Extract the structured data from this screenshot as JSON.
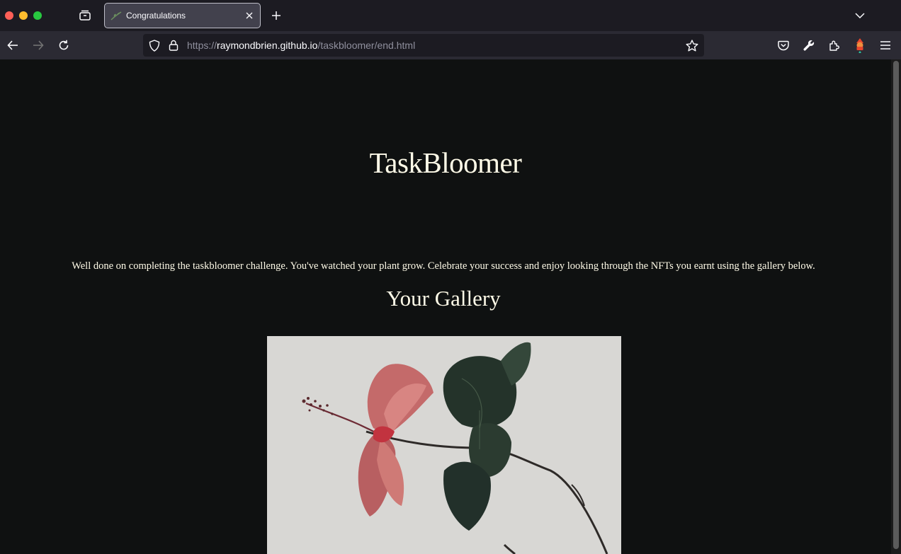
{
  "browser": {
    "tab": {
      "title": "Congratulations"
    },
    "url": {
      "scheme": "https://",
      "host": "raymondbrien.github.io",
      "path": "/taskbloomer/end.html"
    }
  },
  "page": {
    "site_title": "TaskBloomer",
    "intro": "Well done on completing the taskbloomer challenge. You've watched your plant grow. Celebrate your success and enjoy looking through the NFTs you earnt using the gallery below.",
    "gallery_heading": "Your Gallery"
  },
  "colors": {
    "page_background": "#0f1111",
    "text": "#fffbe8",
    "toolbar": "#2b2a33",
    "tabstrip": "#1c1b22"
  },
  "icons": {
    "tab_overview": "tab-overview-icon",
    "favicon": "plant-icon",
    "close": "close-icon",
    "new_tab": "plus-icon",
    "tab_list": "chevron-down-icon",
    "back": "back-arrow-icon",
    "forward": "forward-arrow-icon",
    "reload": "reload-icon",
    "shield": "shield-icon",
    "lock": "lock-icon",
    "bookmark": "star-icon",
    "pocket": "pocket-icon",
    "devtools": "wrench-icon",
    "extensions": "puzzle-icon",
    "profile": "extension-avatar-icon",
    "menu": "hamburger-menu-icon"
  }
}
